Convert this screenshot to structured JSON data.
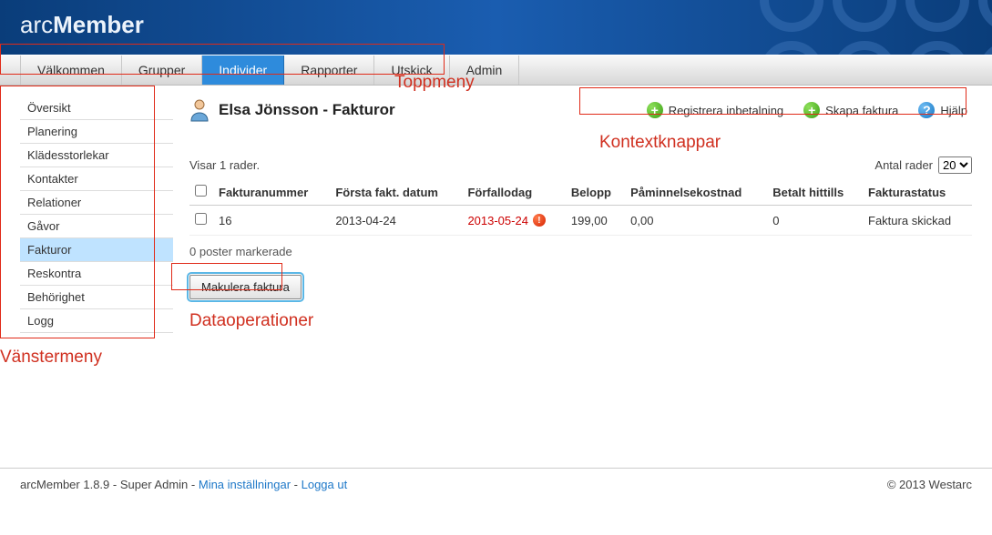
{
  "brand": {
    "pre": "arc",
    "bold": "Member"
  },
  "topmenu": [
    {
      "label": "Välkommen",
      "active": false
    },
    {
      "label": "Grupper",
      "active": false
    },
    {
      "label": "Individer",
      "active": true
    },
    {
      "label": "Rapporter",
      "active": false
    },
    {
      "label": "Utskick",
      "active": false
    },
    {
      "label": "Admin",
      "active": false
    }
  ],
  "sidebar": [
    {
      "label": "Översikt",
      "active": false
    },
    {
      "label": "Planering",
      "active": false
    },
    {
      "label": "Klädesstorlekar",
      "active": false
    },
    {
      "label": "Kontakter",
      "active": false
    },
    {
      "label": "Relationer",
      "active": false
    },
    {
      "label": "Gåvor",
      "active": false
    },
    {
      "label": "Fakturor",
      "active": true
    },
    {
      "label": "Reskontra",
      "active": false
    },
    {
      "label": "Behörighet",
      "active": false
    },
    {
      "label": "Logg",
      "active": false
    }
  ],
  "page_title": "Elsa Jönsson - Fakturor",
  "context_buttons": {
    "register_payment": "Registrera inbetalning",
    "create_invoice": "Skapa faktura",
    "help": "Hjälp"
  },
  "rows_info": "Visar 1 rader.",
  "rows_per_page_label": "Antal rader",
  "rows_per_page_value": "20",
  "table": {
    "headers": {
      "invoice_no": "Fakturanummer",
      "first_date": "Första fakt. datum",
      "due_date": "Förfallodag",
      "amount": "Belopp",
      "reminder_cost": "Påminnelsekostnad",
      "paid": "Betalt hittills",
      "status": "Fakturastatus"
    },
    "rows": [
      {
        "invoice_no": "16",
        "first_date": "2013-04-24",
        "due_date": "2013-05-24",
        "overdue": true,
        "amount": "199,00",
        "reminder_cost": "0,00",
        "paid": "0",
        "status": "Faktura skickad"
      }
    ]
  },
  "selected_count": "0 poster markerade",
  "operations": {
    "cancel_invoice": "Makulera faktura"
  },
  "annotations": {
    "topmenu": "Toppmeny",
    "context": "Kontextknappar",
    "dataops": "Dataoperationer",
    "sidebar": "Vänstermeny"
  },
  "footer": {
    "app": "arcMember 1.8.9",
    "role": "Super Admin",
    "my_settings": "Mina inställningar",
    "logout": "Logga ut",
    "sep": " - ",
    "copyright": "© 2013 Westarc"
  }
}
